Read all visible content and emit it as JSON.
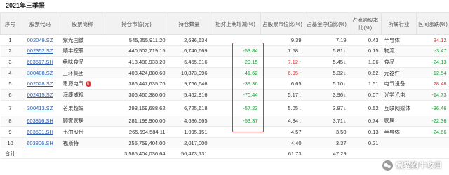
{
  "report_title": "2021年三季报",
  "columns": [
    "序号",
    "股票代码",
    "股票简称",
    "持仓市值(元)",
    "持仓数量",
    "相对上期增减(%)",
    "占股票市值比(%)",
    "占基金净值比(%)",
    "占流通股本比(%)",
    "所属行业",
    "区间涨跌(%)"
  ],
  "rows": [
    {
      "no": "1",
      "code": "002049.SZ",
      "name": "紫光国微",
      "value": "545,255,911.20",
      "qty": "2,636,634",
      "change": "",
      "stock_pct": "9.39",
      "stock_dir": "",
      "nav_pct": "7.19",
      "nav_dir": "",
      "float_pct": "0.43",
      "industry": "半导体",
      "range": "34.12",
      "range_color": "red"
    },
    {
      "no": "2",
      "code": "002352.SZ",
      "name": "顺丰控股",
      "value": "440,502,719.15",
      "qty": "6,740,669",
      "change": "-53.84",
      "stock_pct": "7.58",
      "stock_dir": "down",
      "nav_pct": "5.81",
      "nav_dir": "down",
      "float_pct": "0.15",
      "industry": "物流",
      "range": "-3.47",
      "range_color": "green"
    },
    {
      "no": "3",
      "code": "603517.SH",
      "name": "绝味食品",
      "value": "413,488,933.20",
      "qty": "6,465,816",
      "change": "-29.15",
      "stock_pct": "7.12",
      "stock_dir": "up",
      "nav_pct": "5.45",
      "nav_dir": "down",
      "float_pct": "1.06",
      "industry": "食品",
      "range": "-24.13",
      "range_color": "green"
    },
    {
      "no": "4",
      "code": "300408.SZ",
      "name": "三环集团",
      "value": "403,424,880.60",
      "qty": "10,873,996",
      "change": "-41.62",
      "stock_pct": "6.95",
      "stock_dir": "up",
      "nav_pct": "5.32",
      "nav_dir": "down",
      "float_pct": "0.62",
      "industry": "元器件",
      "range": "-12.54",
      "range_color": "green"
    },
    {
      "no": "5",
      "code": "002028.SZ",
      "name": "思源电气",
      "badge": "6",
      "value": "386,447,635.76",
      "qty": "9,766,646",
      "change": "-39.36",
      "stock_pct": "6.65",
      "stock_dir": "",
      "nav_pct": "5.10",
      "nav_dir": "down",
      "float_pct": "1.51",
      "industry": "电气设备",
      "range": "28.48",
      "range_color": "red"
    },
    {
      "no": "6",
      "code": "002415.SZ",
      "name": "海康威视",
      "value": "306,460,380.00",
      "qty": "5,462,916",
      "change": "-70.44",
      "stock_pct": "5.17",
      "stock_dir": "down",
      "nav_pct": "3.96",
      "nav_dir": "down",
      "float_pct": "0.07",
      "industry": "光学光电",
      "range": "-14.73",
      "range_color": "green"
    },
    {
      "no": "7",
      "code": "300413.SZ",
      "name": "芒果超媒",
      "value": "293,169,688.62",
      "qty": "6,725,618",
      "change": "-57.23",
      "stock_pct": "5.05",
      "stock_dir": "down",
      "nav_pct": "3.87",
      "nav_dir": "down",
      "float_pct": "0.52",
      "industry": "互联网媒体",
      "range": "-36.46",
      "range_color": "green",
      "tall": true
    },
    {
      "no": "8",
      "code": "603816.SH",
      "name": "顾家家居",
      "value": "281,199,900.00",
      "qty": "4,686,665",
      "change": "-53.37",
      "stock_pct": "4.84",
      "stock_dir": "down",
      "nav_pct": "3.71",
      "nav_dir": "down",
      "float_pct": "0.74",
      "industry": "家居",
      "range": "-22.36",
      "range_color": "green"
    },
    {
      "no": "9",
      "code": "603501.SH",
      "name": "韦尔股份",
      "value": "265,694,584.11",
      "qty": "1,095,151",
      "change": "",
      "stock_pct": "4.57",
      "stock_dir": "",
      "nav_pct": "3.50",
      "nav_dir": "",
      "float_pct": "0.13",
      "industry": "半导体",
      "range": "-24.66",
      "range_color": "green"
    },
    {
      "no": "10",
      "code": "603806.SH",
      "name": "福斯特",
      "value": "255,759,404.00",
      "qty": "2,017,000",
      "change": "",
      "stock_pct": "4.40",
      "stock_dir": "",
      "nav_pct": "3.37",
      "nav_dir": "",
      "float_pct": "0.21",
      "industry": "",
      "range": "",
      "range_color": "red"
    }
  ],
  "total": {
    "label": "合计",
    "value": "3,585,404,036.64",
    "qty": "56,473,131",
    "stock_pct": "61.73",
    "nav_pct": "47.29"
  },
  "arrows": {
    "up": "↑",
    "down": "↓"
  },
  "watermark": "懒猫狗牛攻日",
  "colors": {
    "highlight": "#e52f2f",
    "link": "#2a5db0",
    "rise": "#e03131",
    "fall": "#1a9b3a"
  }
}
